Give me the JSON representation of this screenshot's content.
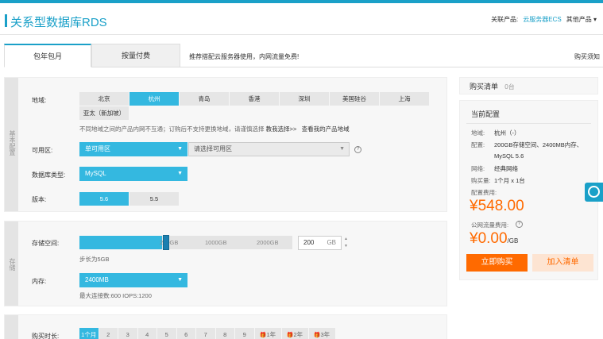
{
  "header": {
    "title": "关系型数据库RDS",
    "related_label": "关联产品:",
    "related_link": "云服务器ECS",
    "other_products": "其他产品"
  },
  "tabs": [
    {
      "label": "包年包月",
      "active": true
    },
    {
      "label": "按量付费",
      "active": false
    }
  ],
  "tab_note": "推荐搭配云服务器使用，内网流量免费!",
  "purchase_help": "购买须知",
  "basic_config": {
    "side_label": "基本配置",
    "region": {
      "label": "地域:",
      "options": [
        "北京",
        "杭州",
        "青岛",
        "香港",
        "深圳",
        "美国硅谷",
        "上海",
        "亚太（新加坡）"
      ],
      "selected": "杭州",
      "hint": "不同地域之间的产品内网不互通；订购后不支持更换地域，请谨慎选择",
      "hint_link1": "教我选择>>",
      "hint_link2": "查看我的产品地域"
    },
    "zone": {
      "label": "可用区:",
      "type_value": "单可用区",
      "zone_placeholder": "请选择可用区"
    },
    "db_type": {
      "label": "数据库类型:",
      "value": "MySQL"
    },
    "version": {
      "label": "版本:",
      "options": [
        "5.6",
        "5.5"
      ],
      "selected": "5.6"
    }
  },
  "storage": {
    "side_label": "存储",
    "space": {
      "label": "存储空间:",
      "ticks": [
        "200GB",
        "1000GB",
        "2000GB"
      ],
      "value": "200",
      "unit": "GB",
      "fill_fraction": 0.08,
      "step_hint": "步长为5GB"
    },
    "memory": {
      "label": "内存:",
      "value": "2400MB",
      "hint": "最大连接数:600 IOPS:1200"
    }
  },
  "duration": {
    "label": "购买时长:",
    "months": [
      "1个月",
      "2",
      "3",
      "4",
      "5",
      "6",
      "7",
      "8",
      "9"
    ],
    "years": [
      "1年",
      "2年",
      "3年"
    ],
    "selected": "1个月"
  },
  "cart": {
    "title": "购买清单",
    "count": "0台"
  },
  "current_config": {
    "title": "当前配置",
    "items": [
      {
        "k": "地域:",
        "v": "杭州（-）"
      },
      {
        "k": "配置:",
        "v": "200GB存储空间、2400MB内存、"
      },
      {
        "k": "",
        "v": "MySQL 5.6"
      },
      {
        "k": "网络:",
        "v": "经典网络"
      },
      {
        "k": "购买量:",
        "v": "1个月 x 1台"
      }
    ],
    "fee_label": "配置费用:",
    "fee": "¥548.00",
    "traffic_label": "公网流量费用:",
    "traffic_fee": "¥0.00",
    "traffic_unit": "/GB",
    "buy_label": "立即购买",
    "add_label": "加入清单"
  },
  "colors": {
    "accent": "#1aa0c8",
    "selected": "#34b8e0",
    "price": "#ff6a00"
  }
}
